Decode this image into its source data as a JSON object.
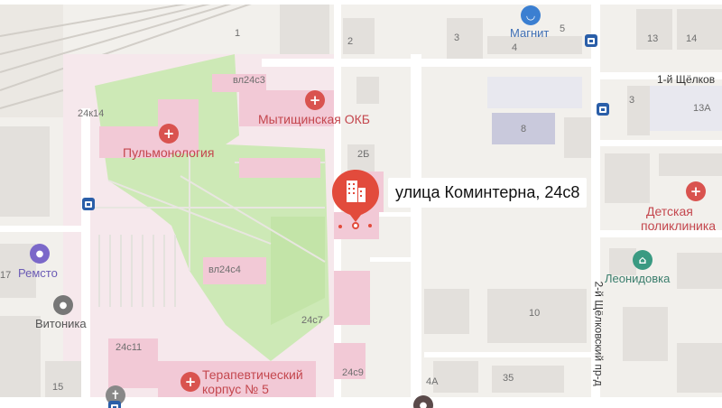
{
  "selected": {
    "address": "улица Коминтерна, 24с8"
  },
  "pois": {
    "okb": "Мытищинская ОКБ",
    "pulmonology": "Пульмонология",
    "therapy_line1": "Терапевтический",
    "therapy_line2": "корпус № 5",
    "magnit": "Магнит",
    "remsto": "Ремсто",
    "vitonika": "Витоника",
    "leonidovka": "Леонидовка",
    "kids_line1": "Детская",
    "kids_line2": "поликлиника"
  },
  "streets": {
    "shchelkovsky_1": "1-й Щёлков",
    "shchelkovsky_2": "2-й Щёлковский пр-д"
  },
  "house_numbers": {
    "h1": "1",
    "h2": "2",
    "h3a": "3",
    "h4": "4",
    "h5": "5",
    "h13": "13",
    "h14": "14",
    "h3b": "3",
    "h13a": "13А",
    "h8": "8",
    "h2b": "2Б",
    "h10": "10",
    "h35": "35",
    "h4a": "4А",
    "h15": "15",
    "h17": "17",
    "vl24c3": "вл24с3",
    "h24k14": "24к14",
    "vl24c4": "вл24с4",
    "h24c7": "24с7",
    "h24c9": "24с9",
    "h24c11": "24с11"
  },
  "colors": {
    "park": "#cce8b5",
    "hospital_area": "#f5e6eb",
    "hospital_building": "#f0c9d6",
    "building": "#e3e0dc",
    "road": "#ffffff",
    "marker": "#e24b3c",
    "medical": "#d9534f",
    "transit": "#2a5ea8",
    "shop": "#3b7fd1",
    "leisure": "#3a9a82",
    "service": "#7b68c9"
  }
}
